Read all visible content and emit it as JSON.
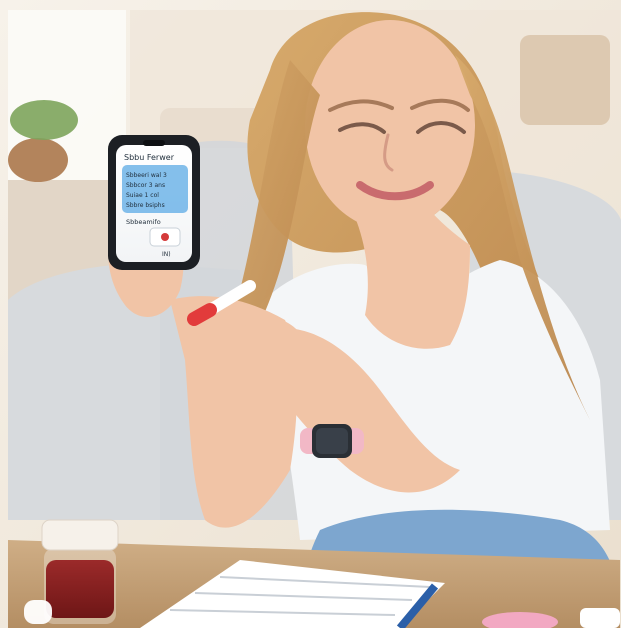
{
  "phone": {
    "title": "Sbbu Ferwer",
    "items": [
      "Sbbeeri wal 3",
      "Sbbcor 3 ans",
      "Suiae 1 col",
      "Sbbre bsiphs"
    ],
    "footer_label": "Sbbeamifo",
    "bottom_text": "IN)"
  },
  "colors": {
    "wall": "#f2e9dc",
    "sofa": "#d8dcdf",
    "table": "#c7a57c",
    "hair": "#c99a5e",
    "skin": "#f1c4a6",
    "tank_top": "#f4f6f8",
    "jeans": "#7da6cf",
    "phone_screen_highlight": "#6fb4e8",
    "liquid": "#8a1f1f",
    "test_cap": "#e23b3b",
    "watch_band": "#f2b8c6"
  },
  "icons": [
    "phone",
    "test-tube",
    "smartwatch",
    "sample-jar",
    "document"
  ]
}
